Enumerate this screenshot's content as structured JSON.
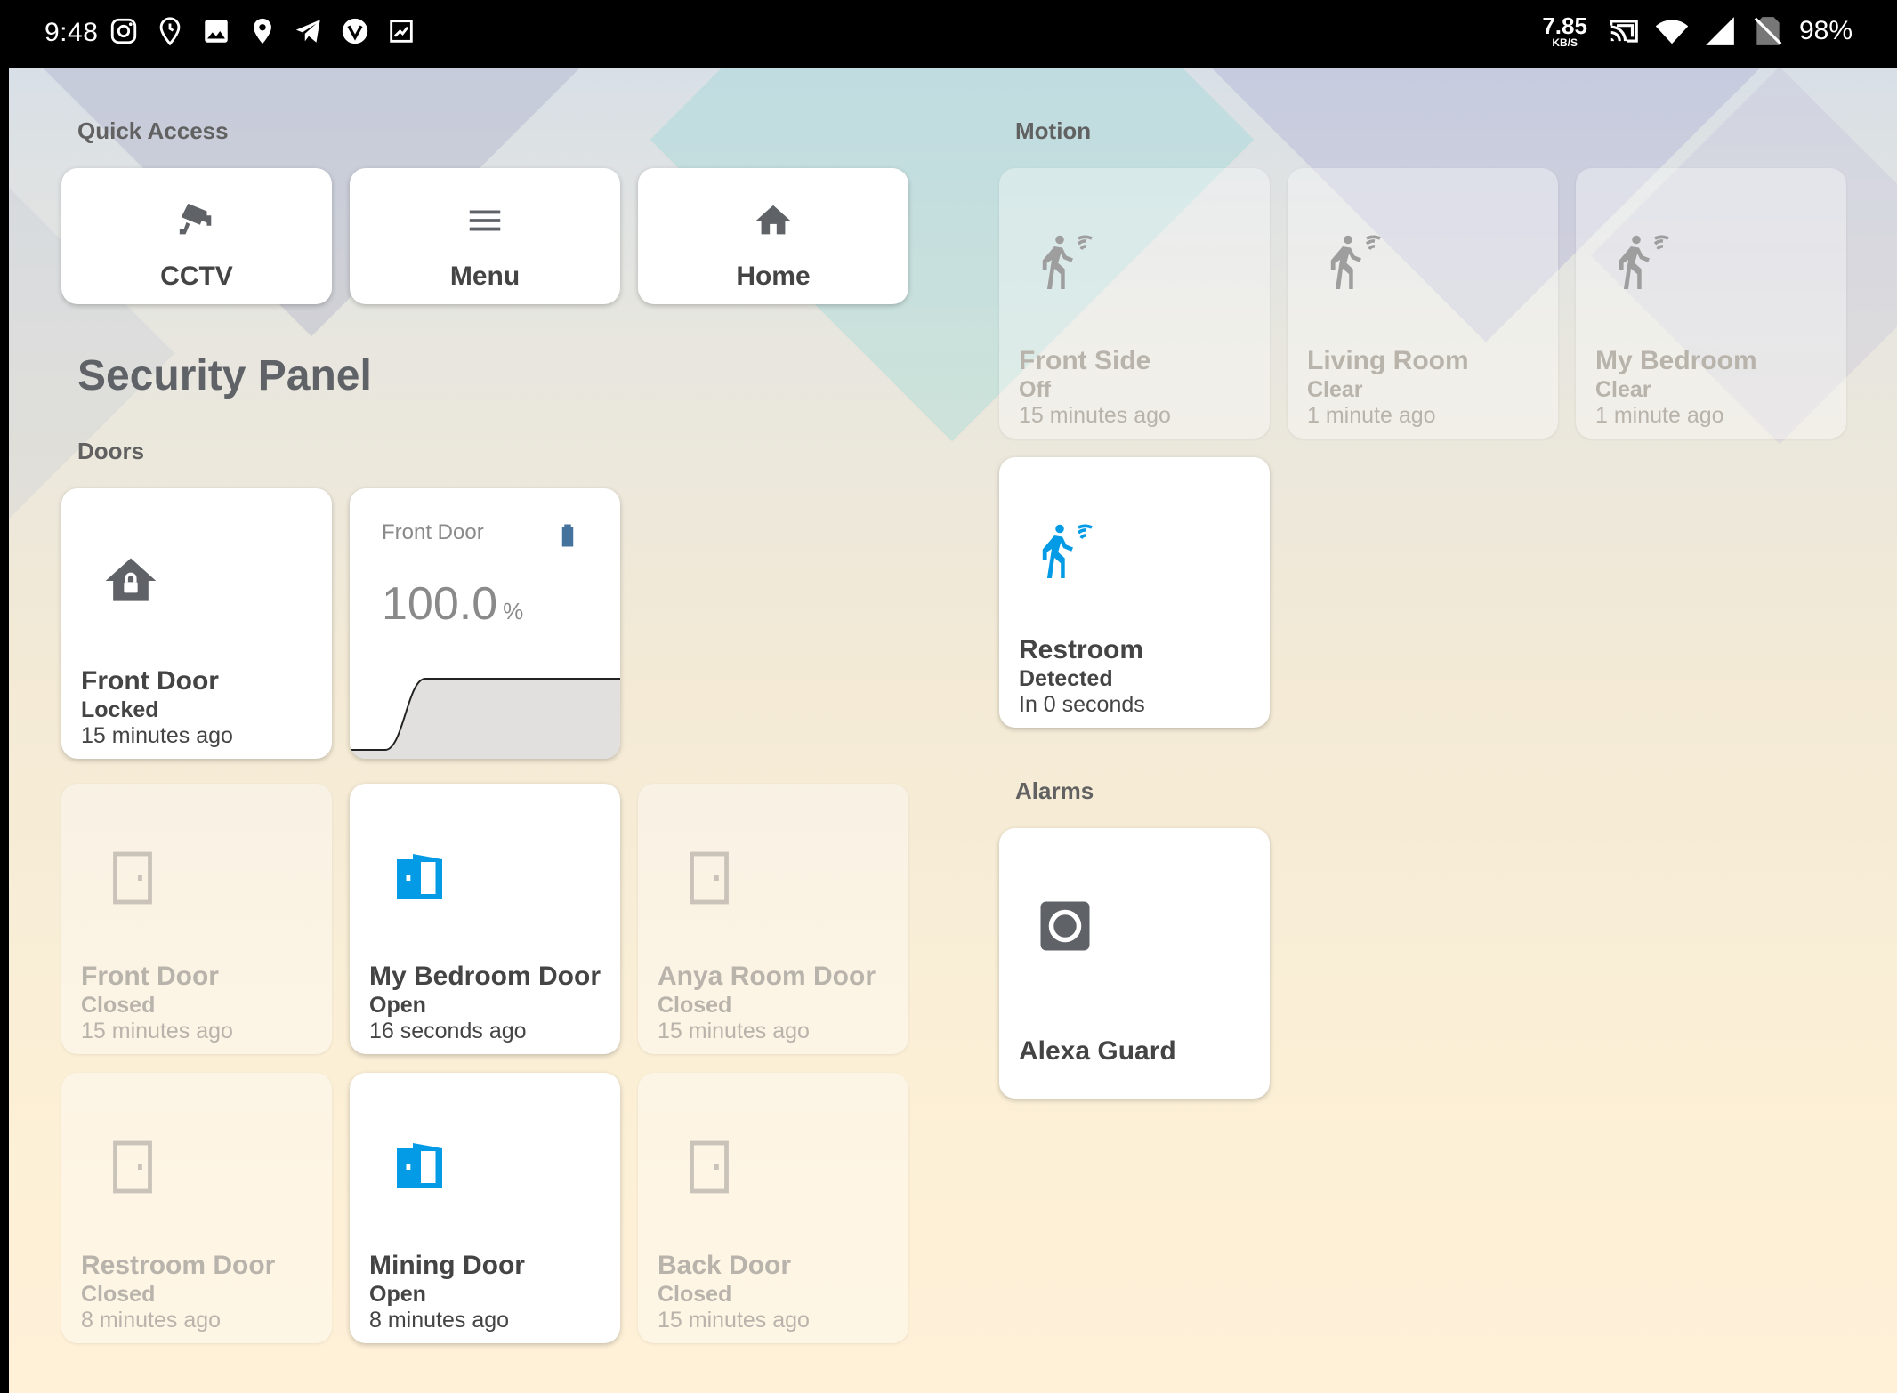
{
  "status_bar": {
    "time": "9:48",
    "net_speed_value": "7.85",
    "net_speed_unit": "KB/S",
    "battery": "98%",
    "left_icons": [
      "instagram-icon",
      "location-history-icon",
      "gallery-icon",
      "location-icon",
      "telegram-icon",
      "vpn-icon",
      "screenshot-icon"
    ],
    "right_icons": [
      "cast-icon",
      "wifi-icon",
      "signal-icon",
      "no-sim-icon"
    ]
  },
  "colors": {
    "accent": "#039be5",
    "icon_active": "#44739e",
    "text": "#444444",
    "text_dim": "#b8b3ab"
  },
  "quick_access": {
    "label": "Quick Access",
    "items": [
      {
        "label": "CCTV",
        "icon": "cctv-icon"
      },
      {
        "label": "Menu",
        "icon": "menu-icon"
      },
      {
        "label": "Home",
        "icon": "home-icon"
      }
    ]
  },
  "page_title": "Security Panel",
  "doors": {
    "label": "Doors",
    "front_lock": {
      "name": "Front Door",
      "state": "Locked",
      "time": "15 minutes ago",
      "icon": "home-lock-icon"
    },
    "battery_sensor": {
      "title": "Front Door",
      "value": "100.0",
      "unit": "%",
      "icon": "battery-icon"
    },
    "tiles": [
      {
        "name": "Front Door",
        "state": "Closed",
        "time": "15 minutes ago",
        "icon": "door-closed-icon"
      },
      {
        "name": "My Bedroom Door",
        "state": "Open",
        "time": "16 seconds ago",
        "icon": "door-open-icon"
      },
      {
        "name": "Anya Room Door",
        "state": "Closed",
        "time": "15 minutes ago",
        "icon": "door-closed-icon"
      },
      {
        "name": "Restroom Door",
        "state": "Closed",
        "time": "8 minutes ago",
        "icon": "door-closed-icon"
      },
      {
        "name": "Mining Door",
        "state": "Open",
        "time": "8 minutes ago",
        "icon": "door-open-icon"
      },
      {
        "name": "Back Door",
        "state": "Closed",
        "time": "15 minutes ago",
        "icon": "door-closed-icon"
      }
    ]
  },
  "motion": {
    "label": "Motion",
    "tiles": [
      {
        "name": "Front Side",
        "state": "Off",
        "time": "15 minutes ago",
        "icon": "motion-sensor-icon"
      },
      {
        "name": "Living Room",
        "state": "Clear",
        "time": "1 minute ago",
        "icon": "motion-sensor-icon"
      },
      {
        "name": "My Bedroom",
        "state": "Clear",
        "time": "1 minute ago",
        "icon": "motion-sensor-icon"
      },
      {
        "name": "Restroom",
        "state": "Detected",
        "time": "In 0 seconds",
        "icon": "motion-sensor-icon"
      }
    ]
  },
  "alarms": {
    "label": "Alarms",
    "tiles": [
      {
        "name": "Alexa Guard",
        "icon": "alarm-guard-icon"
      }
    ]
  }
}
